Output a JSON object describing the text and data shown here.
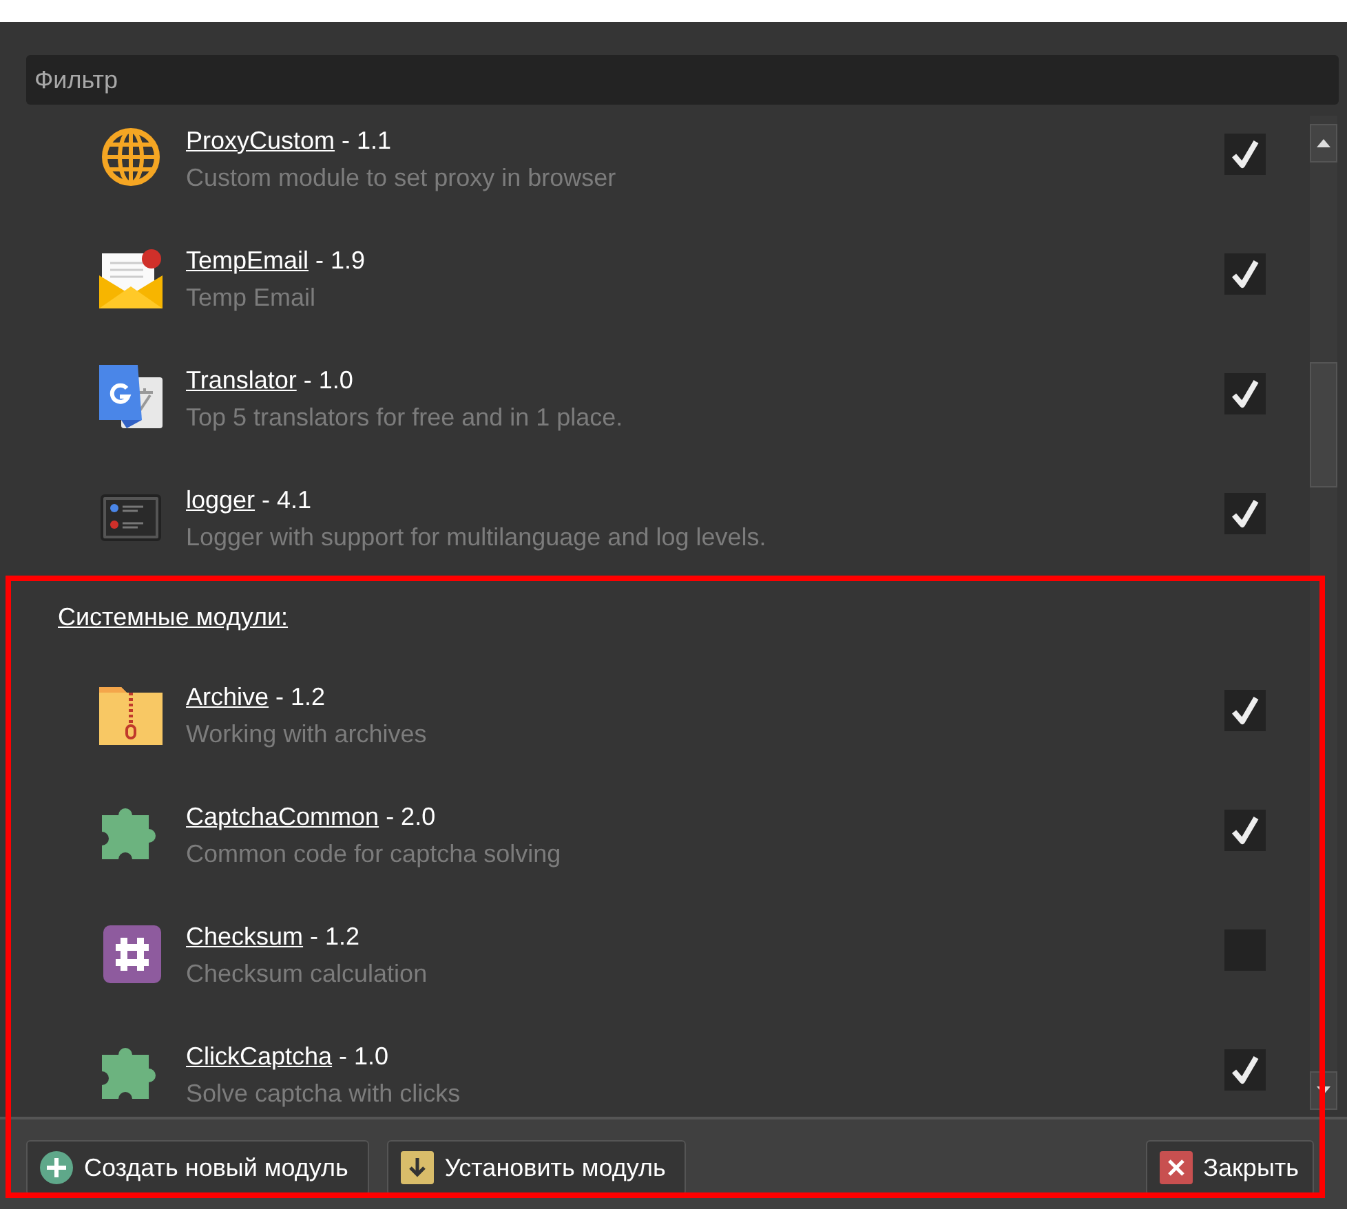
{
  "filter": {
    "placeholder": "Фильтр"
  },
  "entries": [
    {
      "kind": "module",
      "name": "ProxyCustom",
      "version": "- 1.1",
      "description": "Custom module to set proxy in browser",
      "checked": true
    },
    {
      "kind": "module",
      "name": "TempEmail",
      "version": "- 1.9",
      "description": "Temp Email",
      "checked": true
    },
    {
      "kind": "module",
      "name": "Translator",
      "version": "- 1.0",
      "description": "Top 5 translators for free and in 1 place.",
      "checked": true
    },
    {
      "kind": "module",
      "name": "logger",
      "version": "- 4.1",
      "description": "Logger with support for multilanguage and log levels.",
      "checked": true
    },
    {
      "kind": "heading",
      "text": "Системные модули:"
    },
    {
      "kind": "module",
      "name": "Archive",
      "version": "- 1.2",
      "description": "Working with archives",
      "checked": true
    },
    {
      "kind": "module",
      "name": "CaptchaCommon",
      "version": "- 2.0",
      "description": "Common code for captcha solving",
      "checked": true
    },
    {
      "kind": "module",
      "name": "Checksum",
      "version": "- 1.2",
      "description": "Checksum calculation",
      "checked": false
    },
    {
      "kind": "module",
      "name": "ClickCaptcha",
      "version": "- 1.0",
      "description": "Solve captcha with clicks",
      "checked": true
    }
  ],
  "buttons": [
    {
      "label": "Создать новый модуль"
    },
    {
      "label": "Установить модуль"
    },
    {
      "label": "Закрыть"
    }
  ]
}
